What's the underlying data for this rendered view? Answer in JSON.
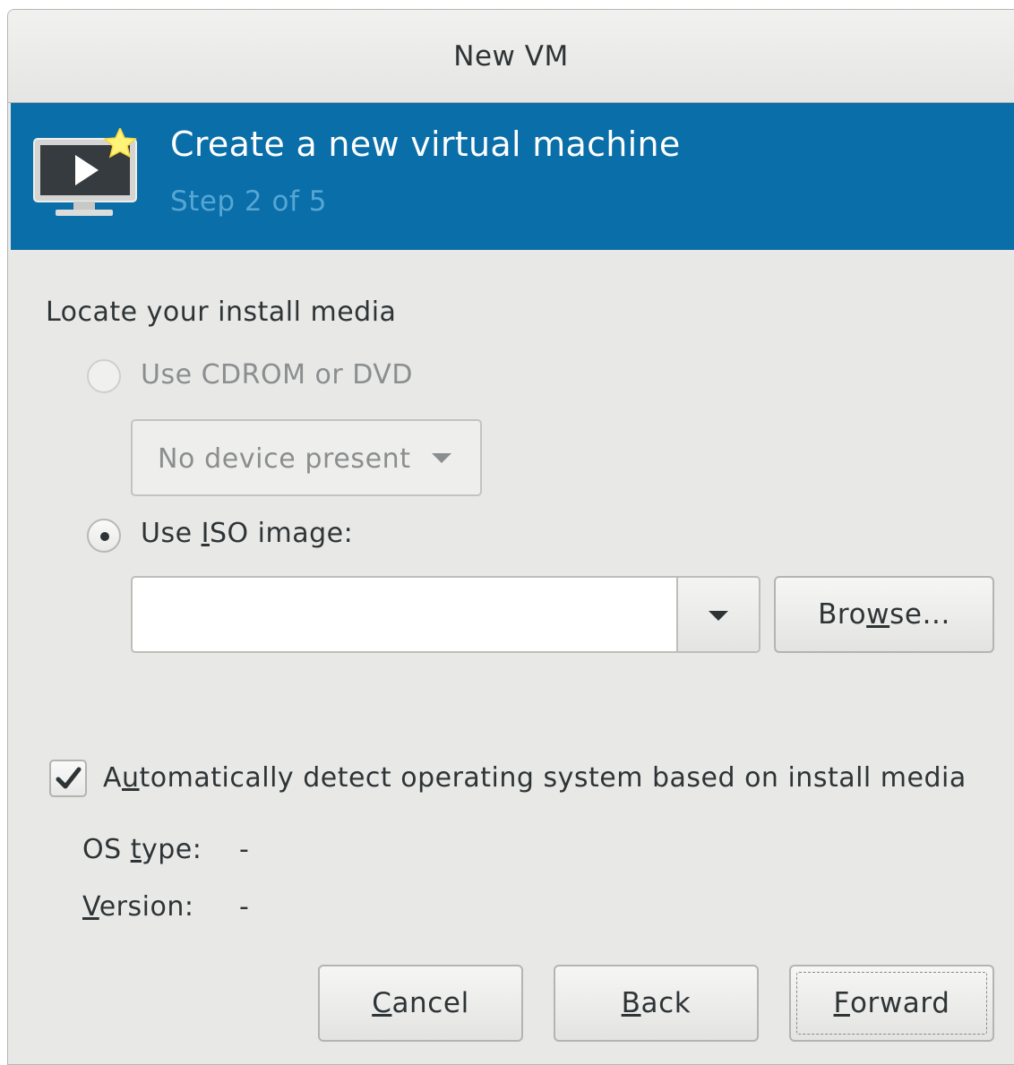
{
  "window": {
    "title": "New VM"
  },
  "banner": {
    "heading": "Create a new virtual machine",
    "step": "Step 2 of 5",
    "icon": "monitor-play-icon"
  },
  "media": {
    "section_label": "Locate your install media",
    "cdrom_option": "Use CDROM or DVD",
    "cdrom_device": "No device present",
    "iso_option_pre": "Use ",
    "iso_option_mnemonic": "I",
    "iso_option_post": "SO image:",
    "iso_path_value": "",
    "browse_pre": "Bro",
    "browse_mnemonic": "w",
    "browse_post": "se...",
    "selected_option": "iso"
  },
  "detect": {
    "checked": true,
    "label_pre": "A",
    "label_mnemonic": "u",
    "label_post": "tomatically detect operating system based on install media",
    "os_type_pre": "OS ",
    "os_type_mnemonic": "t",
    "os_type_post": "ype:",
    "os_type_value": "-",
    "version_mnemonic": "V",
    "version_post": "ersion:",
    "version_value": "-"
  },
  "buttons": {
    "cancel_mnemonic": "C",
    "cancel_post": "ancel",
    "back_mnemonic": "B",
    "back_post": "ack",
    "forward_mnemonic": "F",
    "forward_post": "orward"
  }
}
